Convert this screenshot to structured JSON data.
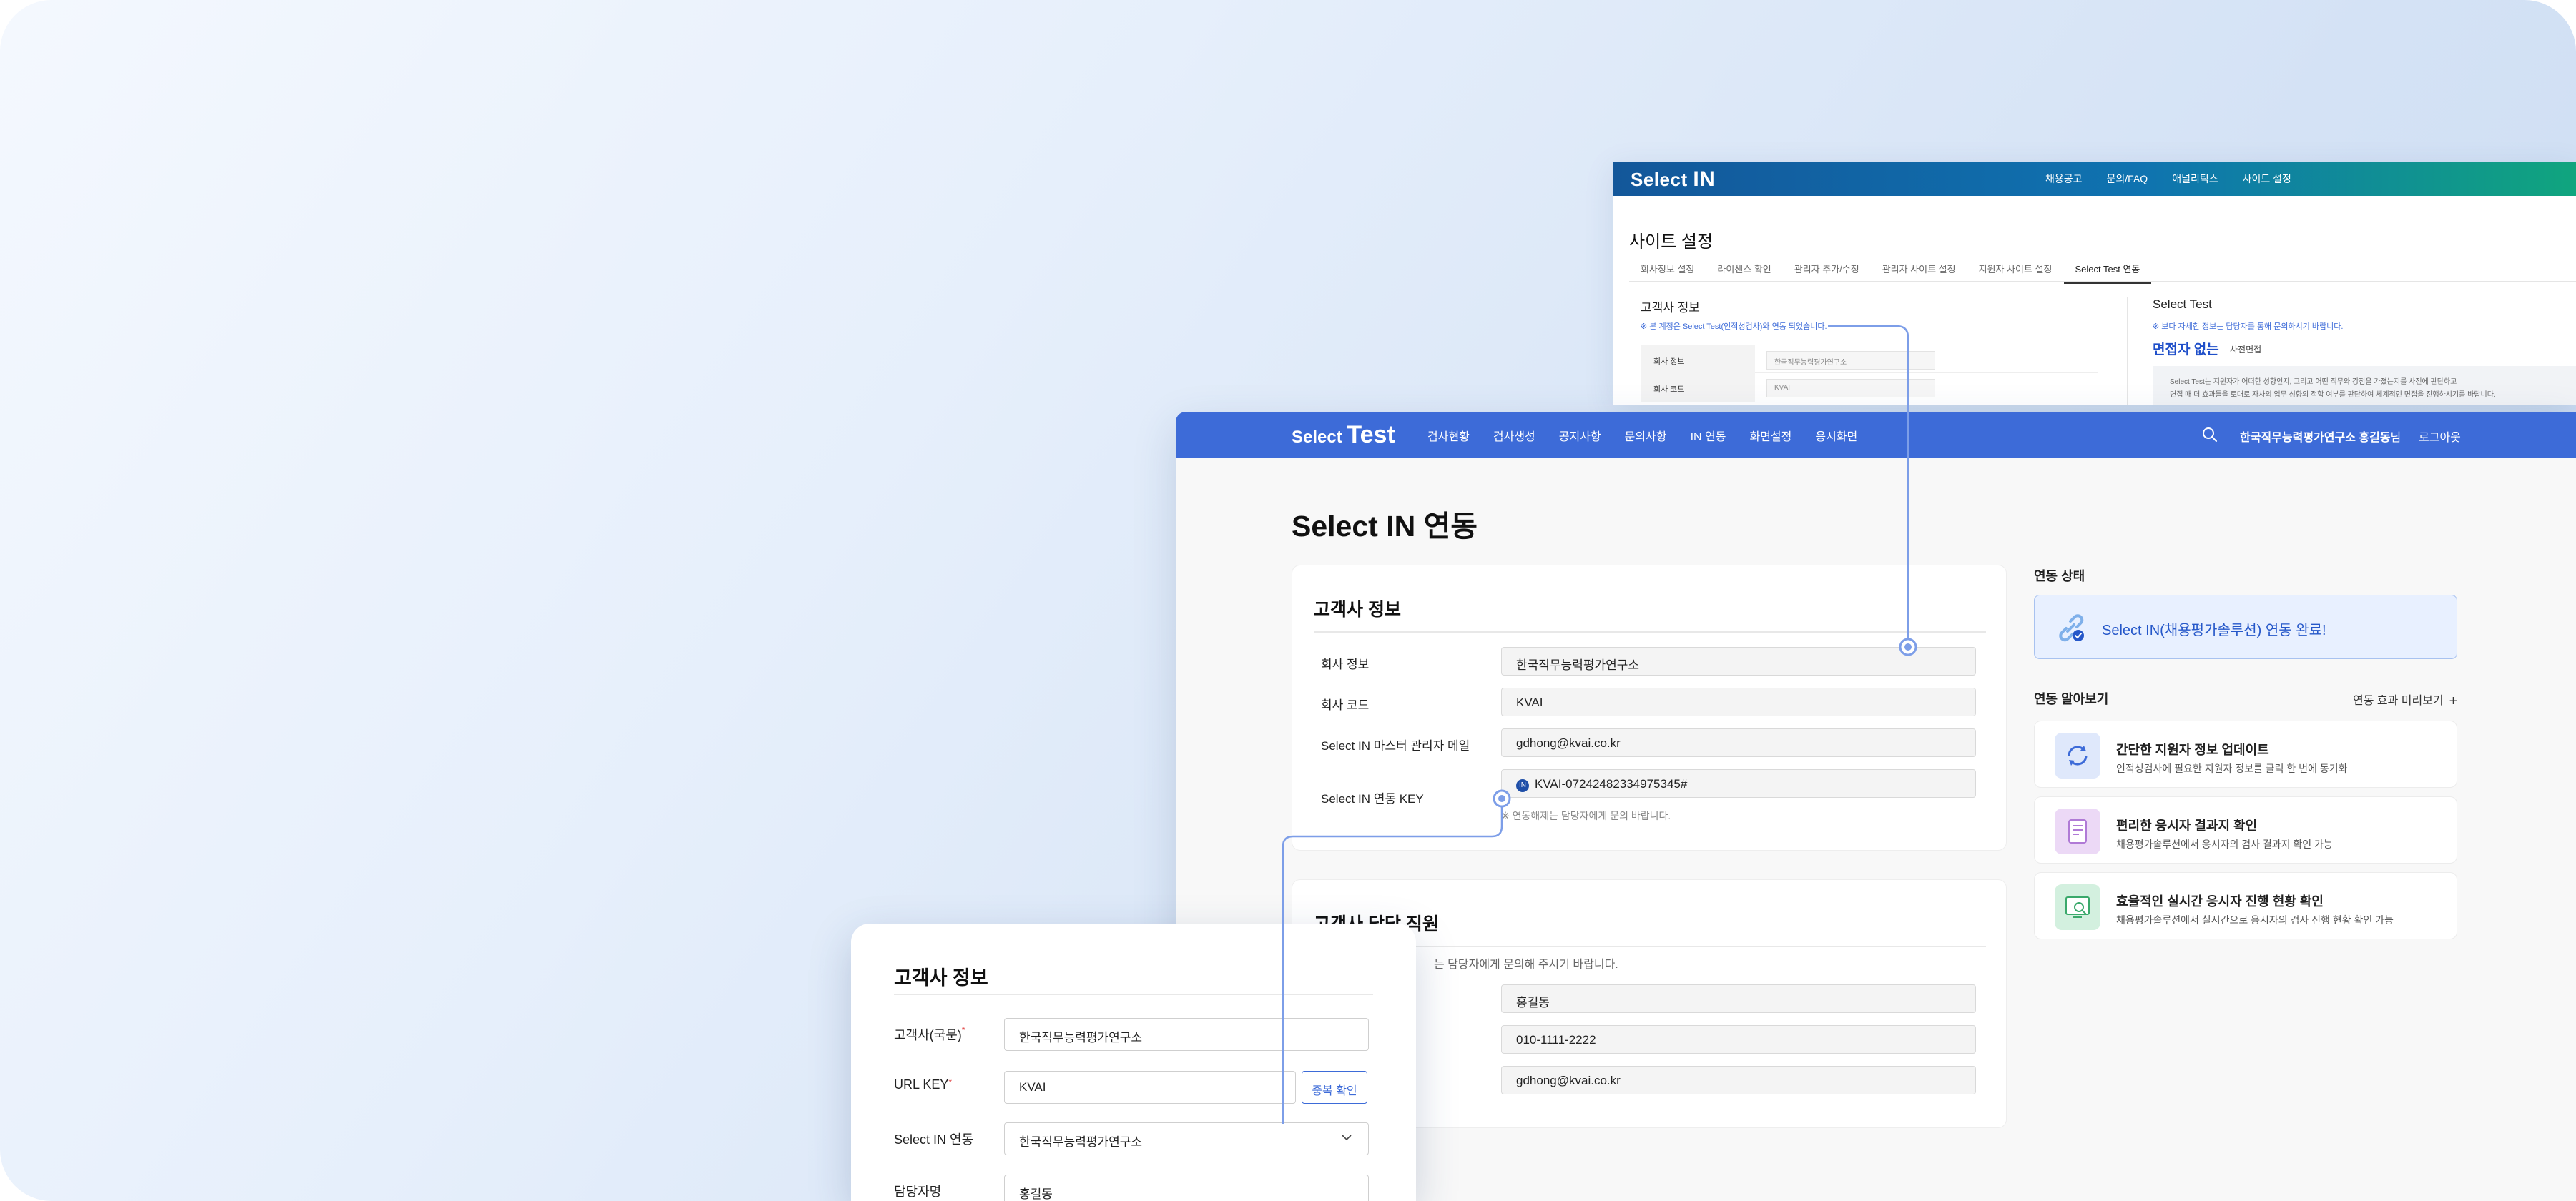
{
  "select_in_window": {
    "logo_text": "Select",
    "logo_big": "IN",
    "nav": [
      "채용공고",
      "문의/FAQ",
      "애널리틱스",
      "사이트 설정"
    ],
    "page_title": "사이트 설정",
    "tabs": [
      "회사정보 설정",
      "라이센스 확인",
      "관리자 추가/수정",
      "관리자 사이트 설정",
      "지원자 사이트 설정",
      "Select Test 연동"
    ],
    "active_tab": "Select Test 연동",
    "customer_heading": "고객사 정보",
    "customer_note": "※ 본 계정은 Select Test(인적성검사)와 연동 되었습니다.",
    "rows": [
      {
        "label": "회사 정보",
        "value": "한국직무능력평가연구소"
      },
      {
        "label": "회사 코드",
        "value": "KVAI"
      }
    ],
    "select_test_heading": "Select Test",
    "select_test_note": "※ 보다 자세한 정보는 담당자를 통해 문의하시기 바랍니다.",
    "select_test_big": "면접자 없는",
    "select_test_small": "사전면접",
    "select_test_desc_1": "Select Test는 지원자가 어떠한 성향인지, 그리고 어떤 직무와 강점을 가졌는지를 사전에 판단하고",
    "select_test_desc_2": "면접 때 더 효과들을 토대로 자사의 업무 성향의 적합 여부를 판단하여 체계적인 면접을 진행하시기를 바랍니다."
  },
  "main_window": {
    "logo_text": "Select",
    "logo_big": "Test",
    "nav": [
      "검사현황",
      "검사생성",
      "공지사항",
      "문의사항",
      "IN 연동",
      "화면설정",
      "응시화면"
    ],
    "user_org": "한국직무능력평가연구소",
    "user_name": "홍길동",
    "user_suffix": "님",
    "logout": "로그아웃",
    "page_title": "Select IN 연동",
    "customer": {
      "heading": "고객사 정보",
      "fields": [
        {
          "label": "회사 정보",
          "value": "한국직무능력평가연구소"
        },
        {
          "label": "회사 코드",
          "value": "KVAI"
        },
        {
          "label": "Select IN 마스터 관리자 메일",
          "value": "gdhong@kvai.co.kr"
        },
        {
          "label": "Select IN 연동 KEY",
          "value": "KVAI-07242482334975345#"
        }
      ],
      "key_badge": "IN",
      "key_note": "※ 연동해제는 담당자에게 문의 바랍니다."
    },
    "staff": {
      "heading": "고객사 담당 직원",
      "note": "는 담당자에게 문의해 주시기 바랍니다.",
      "values": [
        "홍길동",
        "010-1111-2222",
        "gdhong@kvai.co.kr"
      ]
    },
    "status": {
      "heading": "연동 상태",
      "text": "Select IN(채용평가솔루션) 연동 완료!"
    },
    "preview": {
      "heading": "연동 알아보기",
      "more": "연동 효과 미리보기",
      "plus": "+",
      "items": [
        {
          "title": "간단한 지원자 정보 업데이트",
          "sub": "인적성검사에 필요한 지원자 정보를 클릭 한 번에 동기화",
          "icon": "sync-icon",
          "color": "#dfe8fb"
        },
        {
          "title": "편리한 응시자 결과지 확인",
          "sub": "채용평가솔루션에서 응시자의 검사 결과지 확인 가능",
          "icon": "document-icon",
          "color": "#ecd9f6"
        },
        {
          "title": "효율적인 실시간 응시자 진행 현황 확인",
          "sub": "채용평가솔루션에서 실시간으로 응시자의 검사 진행 현황 확인 가능",
          "icon": "monitor-search-icon",
          "color": "#d3f0df"
        }
      ]
    }
  },
  "front_card": {
    "heading": "고객사 정보",
    "fields": [
      {
        "label": "고객사(국문)",
        "required": "*",
        "value": "한국직무능력평가연구소"
      },
      {
        "label": "URL KEY",
        "required": "*",
        "value": "KVAI"
      },
      {
        "label": "Select IN 연동",
        "value": "한국직무능력평가연구소"
      },
      {
        "label": "담당자명",
        "value": "홍길동"
      }
    ],
    "dup_button": "중복 확인"
  },
  "colors": {
    "brand_blue": "#3d6bd8",
    "connector": "#7d9ee8"
  }
}
